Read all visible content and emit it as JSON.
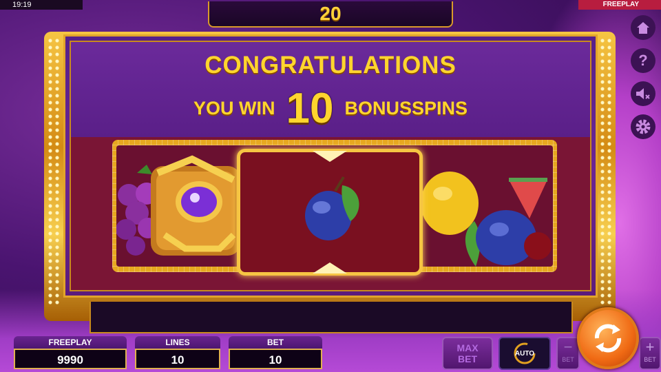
{
  "status_bar": {
    "clock": "19:19",
    "mode": "FREEPLAY"
  },
  "spins_counter": "20",
  "popup": {
    "title": "CONGRATULATIONS",
    "win_prefix": "YOU WIN",
    "win_amount": "10",
    "win_suffix": "BONUSSPINS"
  },
  "reel_symbols": [
    "grapes",
    "treasure-chest",
    "plum",
    "bonus-scatter",
    "lemon",
    "plum",
    "watermelon",
    "cherry"
  ],
  "side_menu": [
    "home-icon",
    "help-icon",
    "mute-icon",
    "settings-icon"
  ],
  "bottom_bar": {
    "freeplay": {
      "label": "FREEPLAY",
      "value": "9990"
    },
    "lines": {
      "label": "LINES",
      "value": "10"
    },
    "bet": {
      "label": "BET",
      "value": "10"
    },
    "max_bet_label": "MAX\nBET",
    "auto_label": "AUTO",
    "bet_minus_label": "BET",
    "bet_plus_label": "BET"
  },
  "colors": {
    "gold": "#ffd52e",
    "frame": "#e2a52a",
    "panel": "#56208a",
    "spin": "#f06a14"
  }
}
